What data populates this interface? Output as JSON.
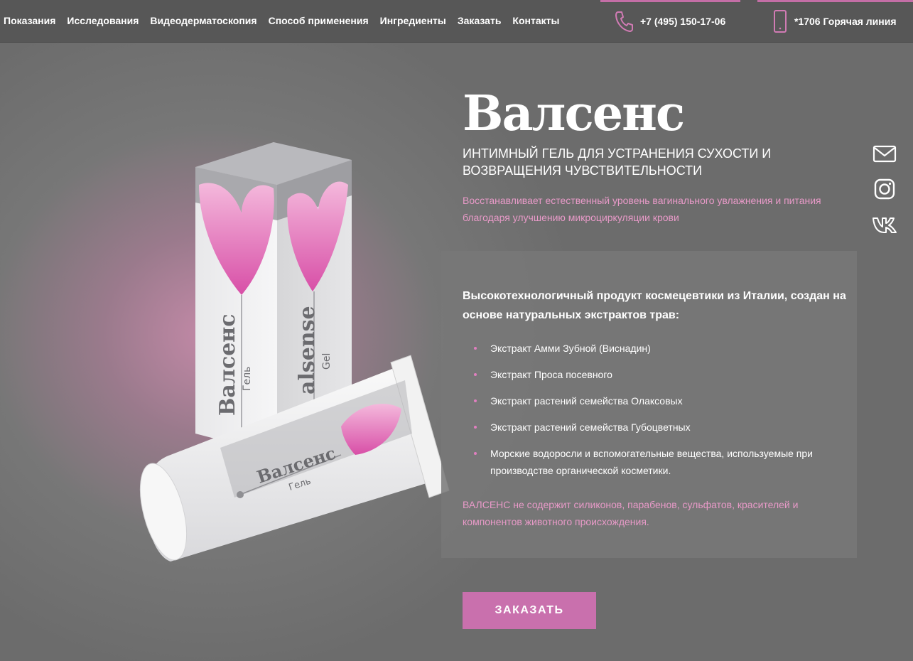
{
  "nav": {
    "items": [
      "Показания",
      "Исследования",
      "Видеодерматоскопия",
      "Способ применения",
      "Ингредиенты",
      "Заказать",
      "Контакты"
    ]
  },
  "contacts": {
    "phone": "+7 (495) 150-17-06",
    "hotline": "*1706 Горячая линия",
    "phone_icon": "phone-icon",
    "hotline_icon": "mobile-phone-icon"
  },
  "hero": {
    "brand": "Валсенс",
    "subtitle": "ИНТИМНЫЙ ГЕЛЬ ДЛЯ УСТРАНЕНИЯ СУХОСТИ И ВОЗВРАЩЕНИЯ ЧУВСТВИТЕЛЬНОСТИ",
    "tagline": "Восстанавливает естественный уровень вагинального увлажнения и питания благодаря улучшению микроциркуляции крови"
  },
  "product": {
    "box_text_ru": "Валсенс",
    "box_sub_ru": "Гель",
    "box_text_en": "alsense",
    "box_sub_en": "Gel",
    "tube_text": "Валсенс",
    "tube_sub": "Гель"
  },
  "info": {
    "title": "Высокотехнологичный продукт космецевтики из Италии, создан на основе натуральных экстрактов трав:",
    "ingredients": [
      "Экстракт Амми Зубной (Виснадин)",
      "Экстракт Проса посевного",
      "Экстракт растений семейства Олаксовых",
      "Экстракт растений семейства Губоцветных",
      "Морские водоросли и вспомогательные вещества, используемые при производстве органической косметики."
    ],
    "note": "ВАЛСЕНС не содержит силиконов, парабенов, сульфатов, красителей и компонентов животного происхождения."
  },
  "cta": {
    "order_label": "ЗАКАЗАТЬ"
  },
  "social": {
    "icons": [
      "mail-icon",
      "instagram-icon",
      "vk-icon"
    ]
  },
  "colors": {
    "accent": "#c970ad",
    "accent_text": "#e89ac8",
    "topbar": "#575757",
    "background": "#6c6c6c"
  }
}
